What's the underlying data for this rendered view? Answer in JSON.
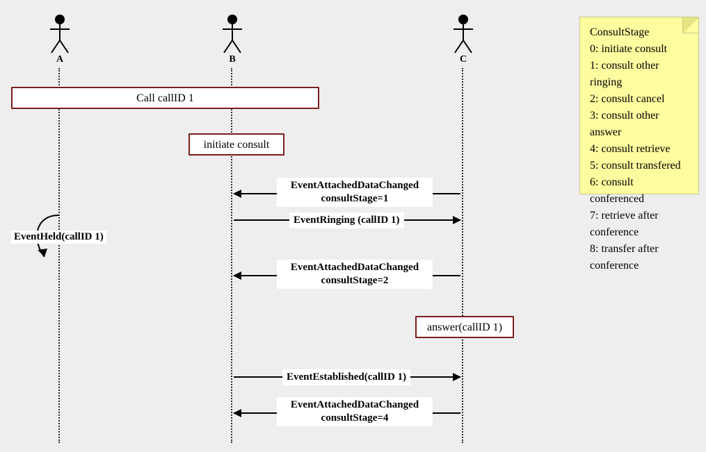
{
  "actors": {
    "a": {
      "label": "A"
    },
    "b": {
      "label": "B"
    },
    "c": {
      "label": "C"
    }
  },
  "boxes": {
    "call": {
      "text": "Call callID 1"
    },
    "initiate": {
      "text": "initiate consult"
    },
    "answer": {
      "text": "answer(callID 1)"
    }
  },
  "messages": {
    "m1": {
      "line1": "EventAttachedDataChanged",
      "line2": "consultStage=1"
    },
    "m2": {
      "line1": "EventRinging (callID 1)"
    },
    "m3": {
      "line1": "EventAttachedDataChanged",
      "line2": "consultStage=2"
    },
    "m4": {
      "line1": "EventEstablished(callID 1)"
    },
    "m5": {
      "line1": "EventAttachedDataChanged",
      "line2": "consultStage=4"
    },
    "self": {
      "label": "EventHeld(callID 1)"
    }
  },
  "note": {
    "title": "ConsultStage",
    "l0": "0: initiate consult",
    "l1": "1: consult other ringing",
    "l2": "2: consult cancel",
    "l3": "3: consult other answer",
    "l4": "4: consult retrieve",
    "l5": "5: consult transfered",
    "l6": "6: consult conferenced",
    "l7": "7: retrieve after conference",
    "l8": "8: transfer after conference"
  },
  "chart_data": {
    "type": "sequence-diagram",
    "actors": [
      "A",
      "B",
      "C"
    ],
    "steps": [
      {
        "kind": "combined-box",
        "participants": [
          "A",
          "B"
        ],
        "label": "Call callID 1"
      },
      {
        "kind": "box",
        "participant": "B",
        "label": "initiate consult"
      },
      {
        "kind": "message",
        "from": "C",
        "to": "B",
        "label": "EventAttachedDataChanged consultStage=1"
      },
      {
        "kind": "self-message",
        "participant": "A",
        "label": "EventHeld(callID 1)"
      },
      {
        "kind": "message",
        "from": "B",
        "to": "C",
        "label": "EventRinging (callID 1)"
      },
      {
        "kind": "message",
        "from": "C",
        "to": "B",
        "label": "EventAttachedDataChanged consultStage=2"
      },
      {
        "kind": "box",
        "participant": "C",
        "label": "answer(callID 1)"
      },
      {
        "kind": "message",
        "from": "B",
        "to": "C",
        "label": "EventEstablished(callID 1)"
      },
      {
        "kind": "message",
        "from": "C",
        "to": "B",
        "label": "EventAttachedDataChanged consultStage=4"
      }
    ],
    "note": {
      "title": "ConsultStage",
      "entries": [
        "0: initiate consult",
        "1: consult other ringing",
        "2: consult cancel",
        "3: consult other answer",
        "4: consult retrieve",
        "5: consult transfered",
        "6: consult conferenced",
        "7: retrieve after conference",
        "8: transfer after conference"
      ]
    }
  }
}
